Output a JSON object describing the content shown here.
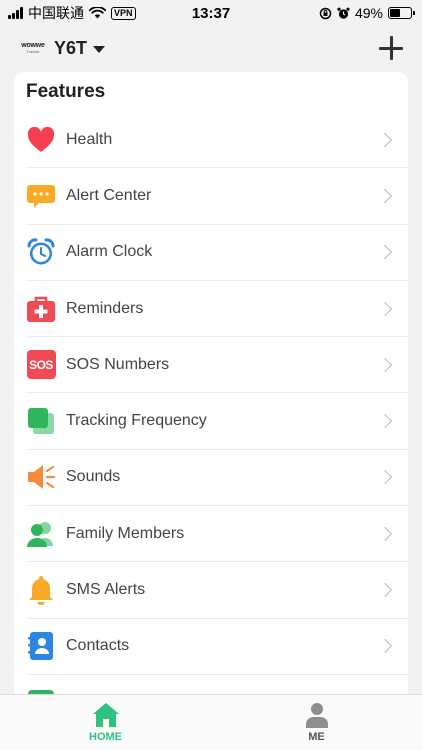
{
  "status_bar": {
    "carrier": "中国联通",
    "vpn": "VPN",
    "time": "13:37",
    "battery": "49%",
    "battery_level": 0.49
  },
  "header": {
    "logo_text": "wowwe",
    "logo_sub": "Tracker",
    "device_name": "Y6T"
  },
  "features": {
    "title": "Features",
    "items": [
      {
        "label": "Health",
        "icon": "heart-icon",
        "color": "#f4404f"
      },
      {
        "label": "Alert Center",
        "icon": "chat-bubble-icon",
        "color": "#f7a928"
      },
      {
        "label": "Alarm Clock",
        "icon": "alarm-clock-icon",
        "color": "#2a86e0"
      },
      {
        "label": "Reminders",
        "icon": "first-aid-kit-icon",
        "color": "#f04b55"
      },
      {
        "label": "SOS Numbers",
        "icon": "sos-icon",
        "color": "#f04b55",
        "icon_text": "SOS"
      },
      {
        "label": "Tracking Frequency",
        "icon": "tracking-squares-icon",
        "color": "#2fb55d"
      },
      {
        "label": "Sounds",
        "icon": "speaker-icon",
        "color": "#f58a3a"
      },
      {
        "label": "Family Members",
        "icon": "people-icon",
        "color": "#2fb55d"
      },
      {
        "label": "SMS Alerts",
        "icon": "bell-icon",
        "color": "#f7a928"
      },
      {
        "label": "Contacts",
        "icon": "contact-book-icon",
        "color": "#2a86e0"
      }
    ]
  },
  "tabs": {
    "home": "HOME",
    "me": "ME",
    "active_color": "#2ec27e",
    "inactive_color": "#8e8e8e"
  }
}
